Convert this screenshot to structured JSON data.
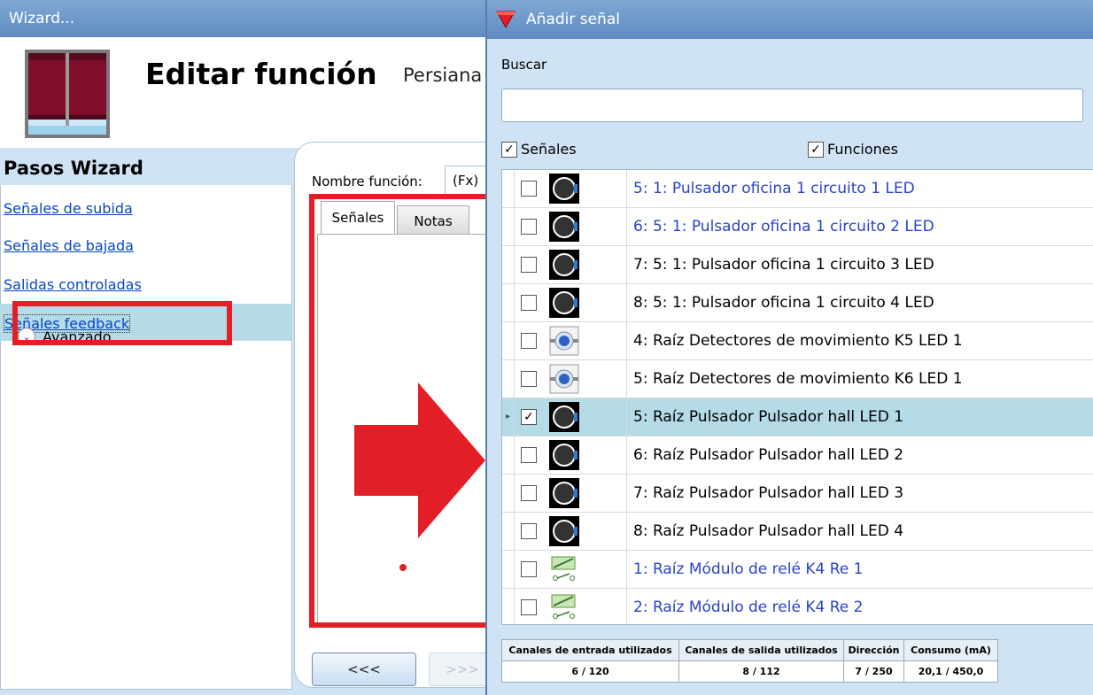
{
  "wizard": {
    "title": "Wizard...",
    "heading": "Editar función",
    "subheading": "Persiana",
    "steps_title": "Pasos Wizard",
    "steps": [
      {
        "label": "Señales de subida"
      },
      {
        "label": "Señales de bajada"
      },
      {
        "label": "Salidas controladas"
      },
      {
        "label": "Señales feedback"
      }
    ],
    "advanced_label": "Avanzado",
    "name_label": "Nombre función:",
    "name_value": "(Fx)",
    "tabs": [
      {
        "label": "Señales"
      },
      {
        "label": "Notas"
      }
    ],
    "back_button": "<<<",
    "next_button": ">>>",
    "icon": "window-blind-icon"
  },
  "add_signal": {
    "title": "Añadir señal",
    "search_label": "Buscar",
    "search_value": "",
    "filter_signals": {
      "label": "Señales",
      "checked": true
    },
    "filter_functions": {
      "label": "Funciones",
      "checked": true
    },
    "rows": [
      {
        "label": "5: 1: Pulsador oficina 1 circuito 1 LED",
        "icon": "pushbutton-icon",
        "blue": true,
        "checked": false
      },
      {
        "label": "6: 5: 1: Pulsador oficina 1 circuito 2 LED",
        "icon": "pushbutton-icon",
        "blue": true,
        "checked": false
      },
      {
        "label": "7: 5: 1: Pulsador oficina 1 circuito 3 LED",
        "icon": "pushbutton-icon",
        "blue": false,
        "checked": false
      },
      {
        "label": "8: 5: 1: Pulsador oficina 1 circuito 4 LED",
        "icon": "pushbutton-icon",
        "blue": false,
        "checked": false
      },
      {
        "label": "4: Raíz Detectores de movimiento K5 LED 1",
        "icon": "motion-detector-icon",
        "blue": false,
        "checked": false
      },
      {
        "label": "5: Raíz Detectores de movimiento K6 LED 1",
        "icon": "motion-detector-icon",
        "blue": false,
        "checked": false
      },
      {
        "label": "5: Raíz Pulsador Pulsador hall LED 1",
        "icon": "pushbutton-icon",
        "blue": false,
        "checked": true,
        "selected": true
      },
      {
        "label": "6: Raíz Pulsador Pulsador hall LED 2",
        "icon": "pushbutton-icon",
        "blue": false,
        "checked": false
      },
      {
        "label": "7: Raíz Pulsador Pulsador hall LED 3",
        "icon": "pushbutton-icon",
        "blue": false,
        "checked": false
      },
      {
        "label": "8: Raíz Pulsador Pulsador hall LED 4",
        "icon": "pushbutton-icon",
        "blue": false,
        "checked": false
      },
      {
        "label": "1: Raíz Módulo de relé K4 Re 1",
        "icon": "relay-module-icon",
        "blue": true,
        "checked": false
      },
      {
        "label": "2: Raíz Módulo de relé K4 Re 2",
        "icon": "relay-module-icon",
        "blue": true,
        "checked": false
      }
    ],
    "status": {
      "headers": [
        "Canales de entrada utilizados",
        "Canales de salida utilizados",
        "Dirección",
        "Consumo (mA)"
      ],
      "values": [
        "6 / 120",
        "8 / 112",
        "7 / 250",
        "20,1 / 450,0"
      ]
    }
  },
  "colors": {
    "highlight_red": "#e21f26",
    "link_blue": "#0645c8",
    "selected_row": "#b5dbe6",
    "titlebar": "#6f98ca"
  }
}
